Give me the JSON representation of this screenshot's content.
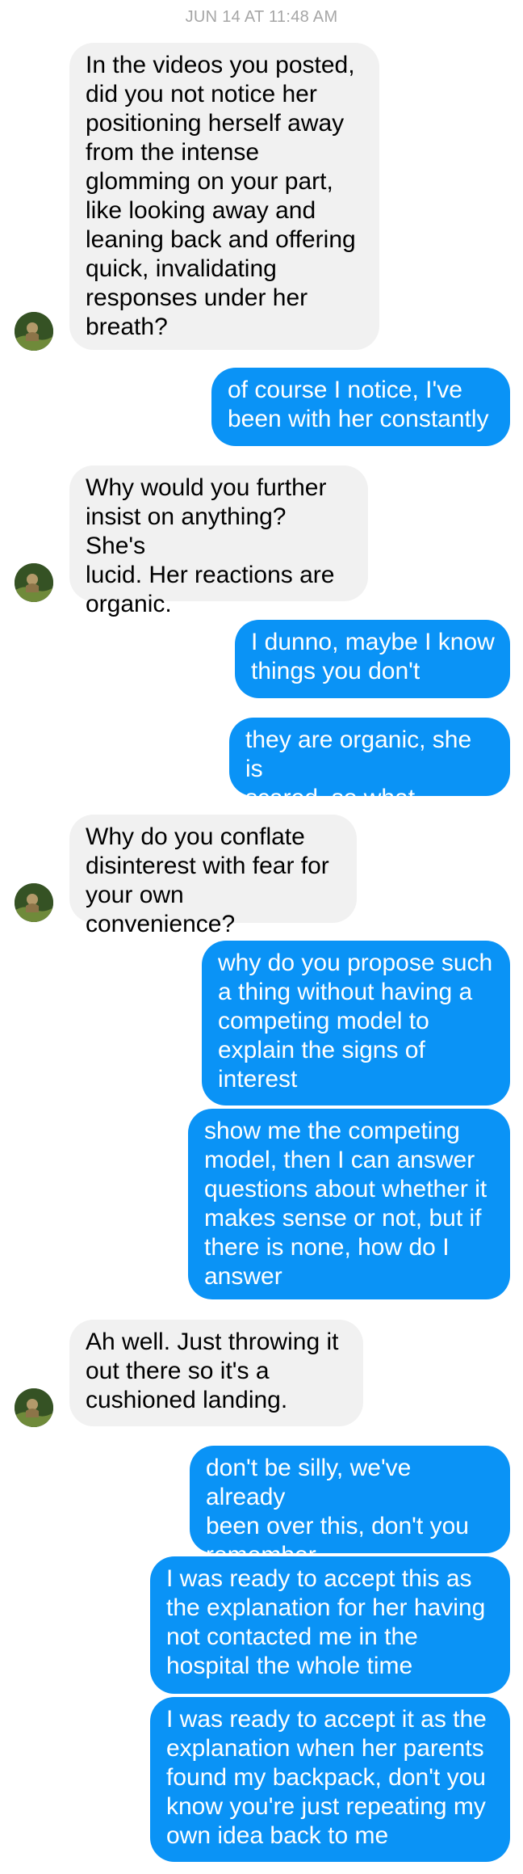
{
  "timestamp": "JUN 14 AT 11:48 AM",
  "messages": [
    {
      "dir": "in",
      "text": "In the videos you posted,\ndid you not notice her\npositioning herself away\nfrom the intense\nglomming on your part,\nlike looking away and\nleaning back and offering\nquick, invalidating\nresponses under her\nbreath?"
    },
    {
      "dir": "out",
      "text": "of course I notice, I've\nbeen with her constantly"
    },
    {
      "dir": "in",
      "text": "Why would you further\ninsist on anything? She's\nlucid. Her reactions are\norganic."
    },
    {
      "dir": "out",
      "text": "I dunno, maybe I know\nthings you don't"
    },
    {
      "dir": "out",
      "text": "they are organic, she is\nscared, so what"
    },
    {
      "dir": "in",
      "text": "Why do you conflate\ndisinterest with fear for\nyour own convenience?"
    },
    {
      "dir": "out",
      "text": "why do you propose such\na thing without having a\ncompeting model to\nexplain the signs of\ninterest"
    },
    {
      "dir": "out",
      "text": "show me the competing\nmodel, then I can answer\nquestions about whether it\nmakes sense or not, but if\nthere is none, how do I\nanswer"
    },
    {
      "dir": "in",
      "text": "Ah well. Just throwing it\nout there so it's a\ncushioned landing."
    },
    {
      "dir": "out",
      "text": "don't be silly, we've already\nbeen over this, don't you\nremember"
    },
    {
      "dir": "out",
      "text": "I was ready to accept this as\nthe explanation for her having\nnot contacted me in the\nhospital the whole time"
    },
    {
      "dir": "out",
      "text": "I was ready to accept it as the\nexplanation when her parents\nfound my backpack, don't you\nknow you're just repeating my\nown idea back to me"
    }
  ]
}
